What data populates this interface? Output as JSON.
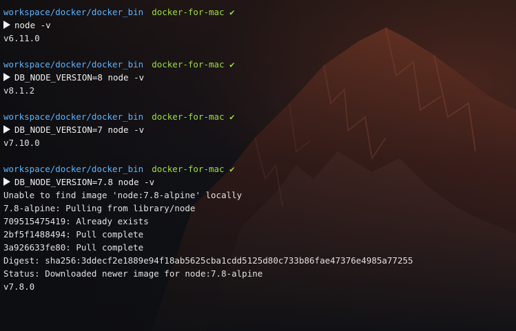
{
  "theme": {
    "path_color": "#5ab4ff",
    "branch_color": "#9ede3c",
    "text_color": "#e0e0e0"
  },
  "icons": {
    "prompt": "prompt-arrow-icon",
    "clean_status": "checkmark-icon"
  },
  "blocks": [
    {
      "prompt": {
        "path": "workspace/docker/docker_bin",
        "branch": "docker-for-mac",
        "status": "✔"
      },
      "command": "node -v",
      "output": [
        "v6.11.0"
      ]
    },
    {
      "prompt": {
        "path": "workspace/docker/docker_bin",
        "branch": "docker-for-mac",
        "status": "✔"
      },
      "command": "DB_NODE_VERSION=8 node -v",
      "output": [
        "v8.1.2"
      ]
    },
    {
      "prompt": {
        "path": "workspace/docker/docker_bin",
        "branch": "docker-for-mac",
        "status": "✔"
      },
      "command": "DB_NODE_VERSION=7 node -v",
      "output": [
        "v7.10.0"
      ]
    },
    {
      "prompt": {
        "path": "workspace/docker/docker_bin",
        "branch": "docker-for-mac",
        "status": "✔"
      },
      "command": "DB_NODE_VERSION=7.8 node -v",
      "output": [
        "Unable to find image 'node:7.8-alpine' locally",
        "7.8-alpine: Pulling from library/node",
        "709515475419: Already exists",
        "2bf5f1488494: Pull complete",
        "3a926633fe80: Pull complete",
        "Digest: sha256:3ddecf2e1889e94f18ab5625cba1cdd5125d80c733b86fae47376e4985a77255",
        "Status: Downloaded newer image for node:7.8-alpine",
        "v7.8.0"
      ]
    }
  ]
}
